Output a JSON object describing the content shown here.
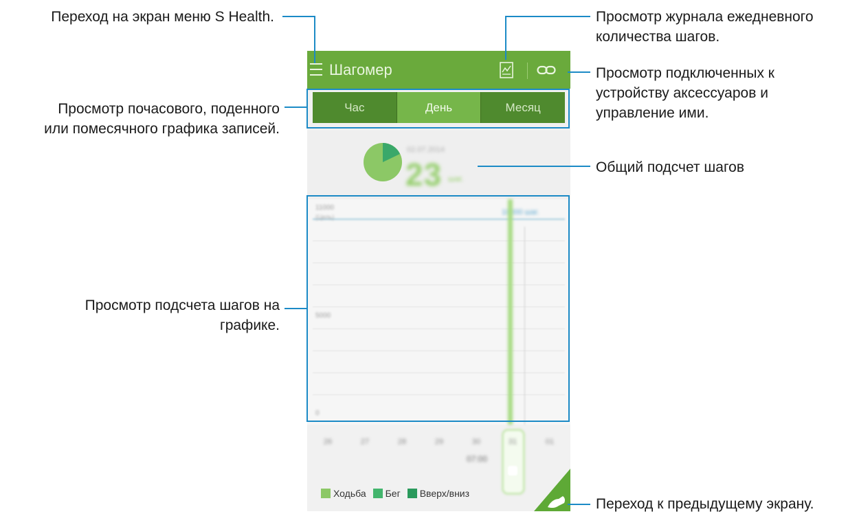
{
  "callouts": {
    "menu": "Переход на экран меню S Health.",
    "periods": [
      "Просмотр почасового, поденного",
      "или помесячного графика записей."
    ],
    "graph": [
      "Просмотр подсчета шагов на",
      "графике."
    ],
    "log": [
      "Просмотр журнала ежедневного",
      "количества шагов."
    ],
    "accessories": [
      "Просмотр подключенных к",
      "устройству аксессуаров и",
      "управление ими."
    ],
    "total": "Общий подсчет шагов",
    "back": "Переход к предыдущему экрану."
  },
  "appbar": {
    "title": "Шагомер",
    "menu_icon": "hamburger-icon",
    "log_icon": "daily-log-icon",
    "link_icon": "link-icon"
  },
  "tabs": [
    {
      "label": "Час",
      "active": false
    },
    {
      "label": "День",
      "active": true
    },
    {
      "label": "Месяц",
      "active": false
    }
  ],
  "summary": {
    "date": "02.07.2014",
    "steps": "23",
    "unit": "шаг."
  },
  "graph": {
    "y_top": "11000",
    "y_top_sub": "(Цель)",
    "y_mid": "5000",
    "y_zero": "0",
    "goal_label": "10000 шаг.",
    "x_ticks": [
      "26",
      "27",
      "28",
      "29",
      "30",
      "31",
      "01"
    ],
    "selected_time": "07:00"
  },
  "legend": [
    {
      "label": "Ходьба",
      "color": "#8cc866"
    },
    {
      "label": "Бег",
      "color": "#43b56d"
    },
    {
      "label": "Вверх/вниз",
      "color": "#2a9a5c"
    }
  ],
  "colors": {
    "appbar": "#6aaa3c",
    "accent_line": "#1b8ac6",
    "pie_main": "#8cc866",
    "pie_slice": "#3aa86a"
  },
  "back_icon": "shoe-icon"
}
